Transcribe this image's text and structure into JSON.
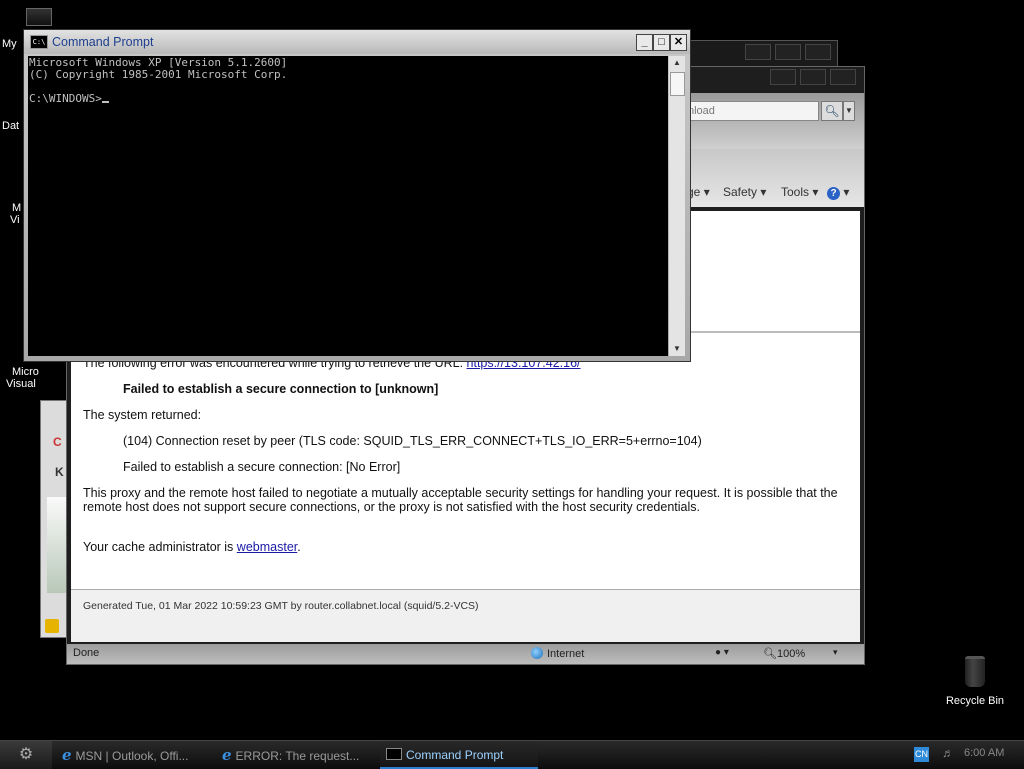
{
  "desktop": {
    "icons": [
      "My",
      "Dat",
      "M",
      "Vi",
      "Micro",
      "Visual"
    ],
    "recycle_bin": "Recycle Bin"
  },
  "ie": {
    "search_placeholder": "nload",
    "menu": {
      "page": "ge",
      "safety": "Safety",
      "tools": "Tools"
    },
    "content": {
      "line1_prefix": "The following error was encountered while trying to retrieve the URL:",
      "line1_url": "https://13.107.42.16/",
      "line2": "Failed to establish a secure connection to [unknown]",
      "line3": "The system returned:",
      "line4": "(104) Connection reset by peer (TLS code: SQUID_TLS_ERR_CONNECT+TLS_IO_ERR=5+errno=104)",
      "line5": "Failed to establish a secure connection: [No Error]",
      "para": "This proxy and the remote host failed to negotiate a mutually acceptable security settings for handling your request. It is possible that the remote host does not support secure connections, or the proxy is not satisfied with the host security credentials.",
      "admin_prefix": "Your cache administrator is",
      "admin_link": "webmaster",
      "admin_suffix": ".",
      "footer": "Generated Tue, 01 Mar 2022 10:59:23 GMT by router.collabnet.local (squid/5.2-VCS)"
    },
    "status": {
      "left": "Done",
      "zone": "Internet",
      "zoom": "100%"
    }
  },
  "cmd": {
    "title": "Command Prompt",
    "lines": [
      "Microsoft Windows XP [Version 5.1.2600]",
      "(C) Copyright 1985-2001 Microsoft Corp.",
      "",
      "C:\\WINDOWS>"
    ]
  },
  "taskbar": {
    "tasks": [
      {
        "label": "MSN | Outlook, Offi..."
      },
      {
        "label": "ERROR: The request..."
      },
      {
        "label": "Command Prompt"
      }
    ],
    "tray": {
      "lang": "CN",
      "time": "6:00 AM"
    }
  }
}
